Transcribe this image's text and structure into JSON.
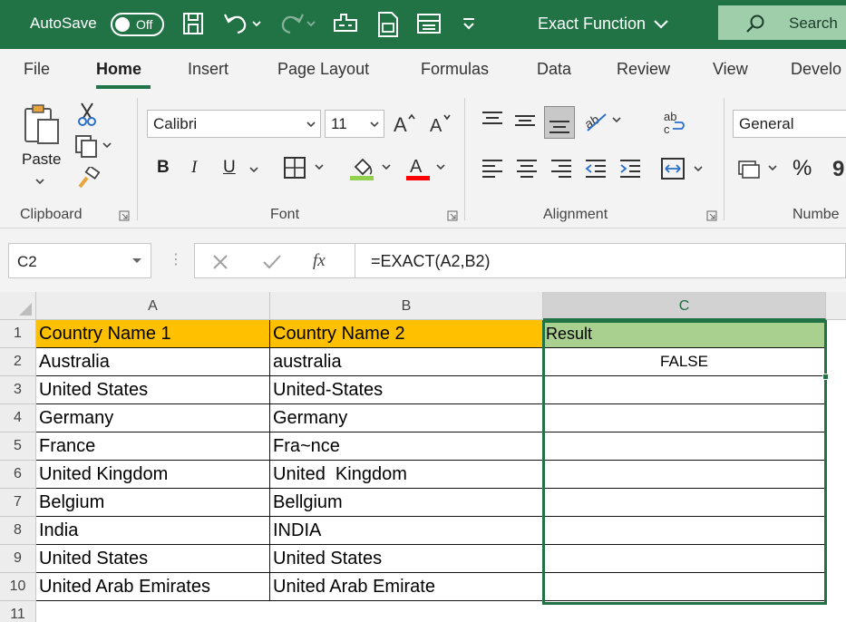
{
  "title_bar": {
    "autosave_label": "AutoSave",
    "autosave_state": "Off",
    "document_title": "Exact Function",
    "search_label": "Search",
    "bg_color": "#217346"
  },
  "ribbon_tabs": [
    "File",
    "Home",
    "Insert",
    "Page Layout",
    "Formulas",
    "Data",
    "Review",
    "View",
    "Develo"
  ],
  "active_tab": "Home",
  "ribbon": {
    "paste_label": "Paste",
    "font_name": "Calibri",
    "font_size": "11",
    "bold": "B",
    "italic": "I",
    "underline": "U",
    "number_format": "General",
    "percent": "%",
    "groups": {
      "clipboard": "Clipboard",
      "font": "Font",
      "alignment": "Alignment",
      "number": "Numbe"
    }
  },
  "formula_bar": {
    "name_box": "C2",
    "formula": "=EXACT(A2,B2)",
    "fx_label": "fx"
  },
  "sheet": {
    "columns": [
      "A",
      "B",
      "C"
    ],
    "selected_column": "C",
    "rows": [
      {
        "num": "1",
        "a": "Country Name 1",
        "b": "Country Name 2",
        "c": "Result"
      },
      {
        "num": "2",
        "a": "Australia",
        "b": "australia",
        "c": "FALSE"
      },
      {
        "num": "3",
        "a": "United States",
        "b": "United-States",
        "c": ""
      },
      {
        "num": "4",
        "a": "Germany",
        "b": "Germany",
        "c": ""
      },
      {
        "num": "5",
        "a": "France",
        "b": "Fra~nce",
        "c": ""
      },
      {
        "num": "6",
        "a": "United Kingdom",
        "b": "United  Kingdom",
        "c": ""
      },
      {
        "num": "7",
        "a": "Belgium",
        "b": "Bellgium",
        "c": ""
      },
      {
        "num": "8",
        "a": "India",
        "b": "INDIA",
        "c": ""
      },
      {
        "num": "9",
        "a": "United States",
        "b": "United States",
        "c": ""
      },
      {
        "num": "10",
        "a": "United Arab Emirates",
        "b": "United Arab Emirate",
        "c": ""
      }
    ],
    "extra_row": "11",
    "header_colors": {
      "gold": "#ffc000",
      "green": "#a9d08e"
    }
  }
}
